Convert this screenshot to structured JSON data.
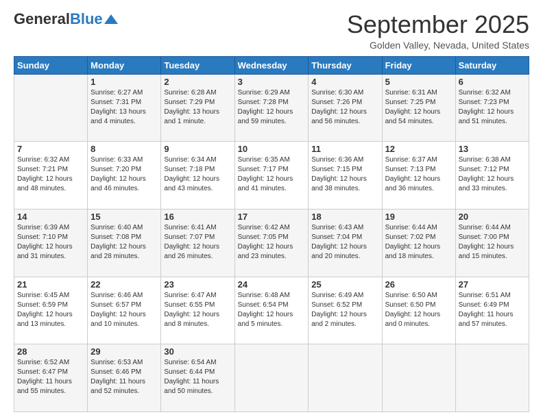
{
  "logo": {
    "general": "General",
    "blue": "Blue"
  },
  "title": "September 2025",
  "location": "Golden Valley, Nevada, United States",
  "days_of_week": [
    "Sunday",
    "Monday",
    "Tuesday",
    "Wednesday",
    "Thursday",
    "Friday",
    "Saturday"
  ],
  "weeks": [
    [
      {
        "day": "",
        "info": ""
      },
      {
        "day": "1",
        "info": "Sunrise: 6:27 AM\nSunset: 7:31 PM\nDaylight: 13 hours\nand 4 minutes."
      },
      {
        "day": "2",
        "info": "Sunrise: 6:28 AM\nSunset: 7:29 PM\nDaylight: 13 hours\nand 1 minute."
      },
      {
        "day": "3",
        "info": "Sunrise: 6:29 AM\nSunset: 7:28 PM\nDaylight: 12 hours\nand 59 minutes."
      },
      {
        "day": "4",
        "info": "Sunrise: 6:30 AM\nSunset: 7:26 PM\nDaylight: 12 hours\nand 56 minutes."
      },
      {
        "day": "5",
        "info": "Sunrise: 6:31 AM\nSunset: 7:25 PM\nDaylight: 12 hours\nand 54 minutes."
      },
      {
        "day": "6",
        "info": "Sunrise: 6:32 AM\nSunset: 7:23 PM\nDaylight: 12 hours\nand 51 minutes."
      }
    ],
    [
      {
        "day": "7",
        "info": "Sunrise: 6:32 AM\nSunset: 7:21 PM\nDaylight: 12 hours\nand 48 minutes."
      },
      {
        "day": "8",
        "info": "Sunrise: 6:33 AM\nSunset: 7:20 PM\nDaylight: 12 hours\nand 46 minutes."
      },
      {
        "day": "9",
        "info": "Sunrise: 6:34 AM\nSunset: 7:18 PM\nDaylight: 12 hours\nand 43 minutes."
      },
      {
        "day": "10",
        "info": "Sunrise: 6:35 AM\nSunset: 7:17 PM\nDaylight: 12 hours\nand 41 minutes."
      },
      {
        "day": "11",
        "info": "Sunrise: 6:36 AM\nSunset: 7:15 PM\nDaylight: 12 hours\nand 38 minutes."
      },
      {
        "day": "12",
        "info": "Sunrise: 6:37 AM\nSunset: 7:13 PM\nDaylight: 12 hours\nand 36 minutes."
      },
      {
        "day": "13",
        "info": "Sunrise: 6:38 AM\nSunset: 7:12 PM\nDaylight: 12 hours\nand 33 minutes."
      }
    ],
    [
      {
        "day": "14",
        "info": "Sunrise: 6:39 AM\nSunset: 7:10 PM\nDaylight: 12 hours\nand 31 minutes."
      },
      {
        "day": "15",
        "info": "Sunrise: 6:40 AM\nSunset: 7:08 PM\nDaylight: 12 hours\nand 28 minutes."
      },
      {
        "day": "16",
        "info": "Sunrise: 6:41 AM\nSunset: 7:07 PM\nDaylight: 12 hours\nand 26 minutes."
      },
      {
        "day": "17",
        "info": "Sunrise: 6:42 AM\nSunset: 7:05 PM\nDaylight: 12 hours\nand 23 minutes."
      },
      {
        "day": "18",
        "info": "Sunrise: 6:43 AM\nSunset: 7:04 PM\nDaylight: 12 hours\nand 20 minutes."
      },
      {
        "day": "19",
        "info": "Sunrise: 6:44 AM\nSunset: 7:02 PM\nDaylight: 12 hours\nand 18 minutes."
      },
      {
        "day": "20",
        "info": "Sunrise: 6:44 AM\nSunset: 7:00 PM\nDaylight: 12 hours\nand 15 minutes."
      }
    ],
    [
      {
        "day": "21",
        "info": "Sunrise: 6:45 AM\nSunset: 6:59 PM\nDaylight: 12 hours\nand 13 minutes."
      },
      {
        "day": "22",
        "info": "Sunrise: 6:46 AM\nSunset: 6:57 PM\nDaylight: 12 hours\nand 10 minutes."
      },
      {
        "day": "23",
        "info": "Sunrise: 6:47 AM\nSunset: 6:55 PM\nDaylight: 12 hours\nand 8 minutes."
      },
      {
        "day": "24",
        "info": "Sunrise: 6:48 AM\nSunset: 6:54 PM\nDaylight: 12 hours\nand 5 minutes."
      },
      {
        "day": "25",
        "info": "Sunrise: 6:49 AM\nSunset: 6:52 PM\nDaylight: 12 hours\nand 2 minutes."
      },
      {
        "day": "26",
        "info": "Sunrise: 6:50 AM\nSunset: 6:50 PM\nDaylight: 12 hours\nand 0 minutes."
      },
      {
        "day": "27",
        "info": "Sunrise: 6:51 AM\nSunset: 6:49 PM\nDaylight: 11 hours\nand 57 minutes."
      }
    ],
    [
      {
        "day": "28",
        "info": "Sunrise: 6:52 AM\nSunset: 6:47 PM\nDaylight: 11 hours\nand 55 minutes."
      },
      {
        "day": "29",
        "info": "Sunrise: 6:53 AM\nSunset: 6:46 PM\nDaylight: 11 hours\nand 52 minutes."
      },
      {
        "day": "30",
        "info": "Sunrise: 6:54 AM\nSunset: 6:44 PM\nDaylight: 11 hours\nand 50 minutes."
      },
      {
        "day": "",
        "info": ""
      },
      {
        "day": "",
        "info": ""
      },
      {
        "day": "",
        "info": ""
      },
      {
        "day": "",
        "info": ""
      }
    ]
  ]
}
